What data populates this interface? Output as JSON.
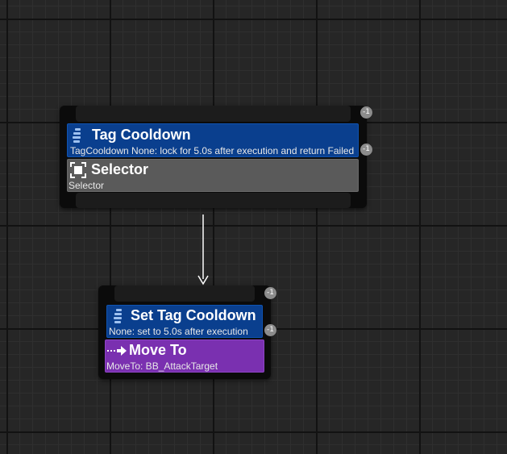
{
  "nodes": {
    "selector_node": {
      "decorator": {
        "title": "Tag Cooldown",
        "description": "TagCooldown None: lock for 5.0s after execution and return Failed",
        "icon": "decorator-icon",
        "index": "-1"
      },
      "composite": {
        "title": "Selector",
        "description": "Selector",
        "icon": "selector-icon"
      },
      "index": "-1"
    },
    "task_node": {
      "decorator": {
        "title": "Set Tag Cooldown",
        "description": "None: set to 5.0s after execution",
        "icon": "decorator-icon",
        "index": "-1"
      },
      "task": {
        "title": "Move To",
        "description": "MoveTo: BB_AttackTarget",
        "icon": "move-to-icon"
      },
      "index": "-1"
    }
  },
  "colors": {
    "decorator": "#0a3f8e",
    "composite": "#5a5a5a",
    "task": "#7a30b0",
    "connection": "#ffffff"
  }
}
